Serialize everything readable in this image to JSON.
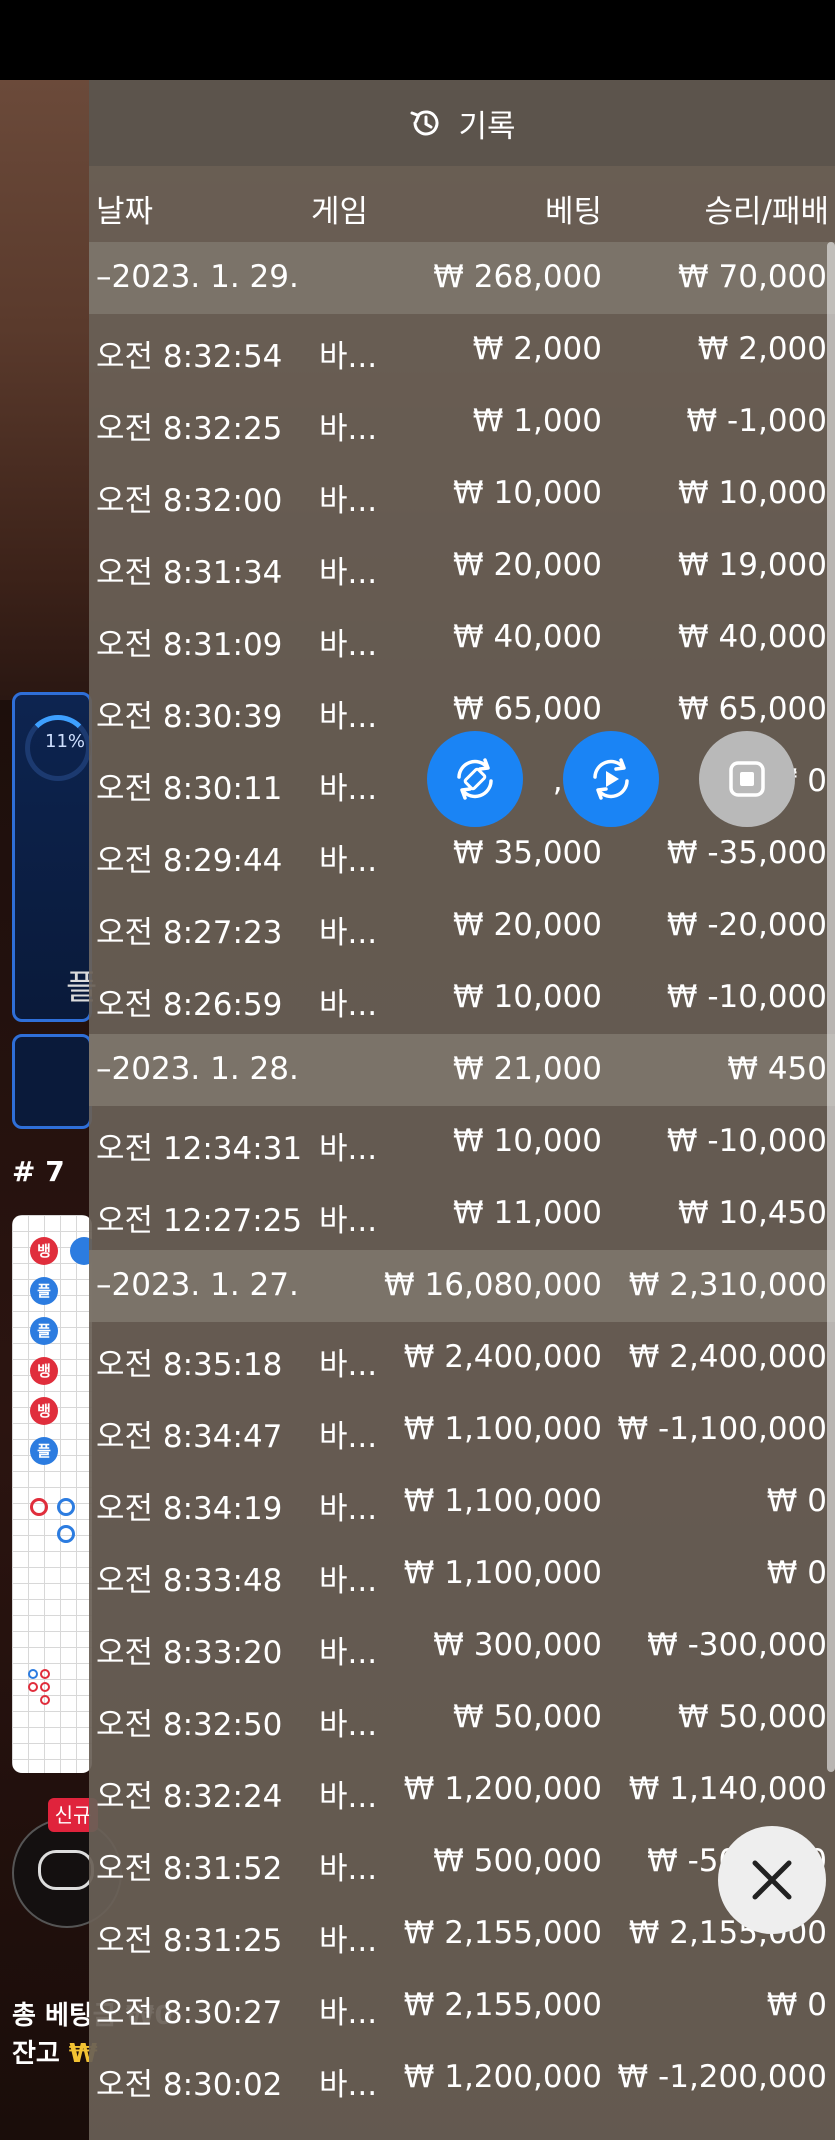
{
  "header": {
    "title": "기록"
  },
  "columns": {
    "date": "날짜",
    "game": "게임",
    "bet": "베팅",
    "winloss": "승리/패배"
  },
  "rows": [
    {
      "type": "date",
      "label": "–2023. 1. 29.",
      "bet": "₩ 268,000",
      "result": "₩ 70,000"
    },
    {
      "type": "entry",
      "time": "오전 8:32:54",
      "game": "바...",
      "bet": "₩ 2,000",
      "result": "₩ 2,000"
    },
    {
      "type": "entry",
      "time": "오전 8:32:25",
      "game": "바...",
      "bet": "₩ 1,000",
      "result": "₩ -1,000"
    },
    {
      "type": "entry",
      "time": "오전 8:32:00",
      "game": "바...",
      "bet": "₩ 10,000",
      "result": "₩ 10,000"
    },
    {
      "type": "entry",
      "time": "오전 8:31:34",
      "game": "바...",
      "bet": "₩ 20,000",
      "result": "₩ 19,000"
    },
    {
      "type": "entry",
      "time": "오전 8:31:09",
      "game": "바...",
      "bet": "₩ 40,000",
      "result": "₩ 40,000"
    },
    {
      "type": "entry",
      "time": "오전 8:30:39",
      "game": "바...",
      "bet": "₩ 65,000",
      "result": "₩ 65,000"
    },
    {
      "type": "entry",
      "time": "오전 8:30:11",
      "game": "바...",
      "bet": ",00",
      "result": "₩ 0"
    },
    {
      "type": "entry",
      "time": "오전 8:29:44",
      "game": "바...",
      "bet": "₩ 35,000",
      "result": "₩ -35,000"
    },
    {
      "type": "entry",
      "time": "오전 8:27:23",
      "game": "바...",
      "bet": "₩ 20,000",
      "result": "₩ -20,000"
    },
    {
      "type": "entry",
      "time": "오전 8:26:59",
      "game": "바...",
      "bet": "₩ 10,000",
      "result": "₩ -10,000"
    },
    {
      "type": "date",
      "label": "–2023. 1. 28.",
      "bet": "₩ 21,000",
      "result": "₩ 450"
    },
    {
      "type": "entry",
      "time": "오전 12:34:31",
      "game": "바...",
      "bet": "₩ 10,000",
      "result": "₩ -10,000"
    },
    {
      "type": "entry",
      "time": "오전 12:27:25",
      "game": "바...",
      "bet": "₩ 11,000",
      "result": "₩ 10,450"
    },
    {
      "type": "date",
      "label": "–2023. 1. 27.",
      "bet": "₩ 16,080,000",
      "result": "₩ 2,310,000"
    },
    {
      "type": "entry",
      "time": "오전 8:35:18",
      "game": "바...",
      "bet": "₩ 2,400,000",
      "result": "₩ 2,400,000"
    },
    {
      "type": "entry",
      "time": "오전 8:34:47",
      "game": "바...",
      "bet": "₩ 1,100,000",
      "result": "₩ -1,100,000"
    },
    {
      "type": "entry",
      "time": "오전 8:34:19",
      "game": "바...",
      "bet": "₩ 1,100,000",
      "result": "₩ 0"
    },
    {
      "type": "entry",
      "time": "오전 8:33:48",
      "game": "바...",
      "bet": "₩ 1,100,000",
      "result": "₩ 0"
    },
    {
      "type": "entry",
      "time": "오전 8:33:20",
      "game": "바...",
      "bet": "₩ 300,000",
      "result": "₩ -300,000"
    },
    {
      "type": "entry",
      "time": "오전 8:32:50",
      "game": "바...",
      "bet": "₩ 50,000",
      "result": "₩ 50,000"
    },
    {
      "type": "entry",
      "time": "오전 8:32:24",
      "game": "바...",
      "bet": "₩ 1,200,000",
      "result": "₩ 1,140,000"
    },
    {
      "type": "entry",
      "time": "오전 8:31:52",
      "game": "바...",
      "bet": "₩ 500,000",
      "result": "₩ -500,000"
    },
    {
      "type": "entry",
      "time": "오전 8:31:25",
      "game": "바...",
      "bet": "₩ 2,155,000",
      "result": "₩ 2,155,000"
    },
    {
      "type": "entry",
      "time": "오전 8:30:27",
      "game": "바...",
      "bet": "₩ 2,155,000",
      "result": "₩ 0"
    },
    {
      "type": "entry",
      "time": "오전 8:30:02",
      "game": "바...",
      "bet": "₩ 1,200,000",
      "result": "₩ -1,200,000"
    }
  ],
  "background": {
    "progress": "11%",
    "round": "# 7",
    "panel_char": "플",
    "new_badge": "신규",
    "total_bet_label": "총 베팅금 ₩0",
    "balance_label": "잔고 ",
    "balance_value": "₩",
    "road_marks": [
      "뱅",
      "플",
      "플",
      "뱅",
      "뱅",
      "플"
    ],
    "banker_color": "#e02e3c",
    "player_color": "#2c7ce0"
  },
  "icons": {
    "history": "history-icon",
    "rotate": "rotate-screen-icon",
    "replay": "replay-icon",
    "stop": "stop-recording-icon",
    "close": "close-icon"
  },
  "colors": {
    "accent_blue": "#1a84f5",
    "overlay": "#69605a"
  }
}
